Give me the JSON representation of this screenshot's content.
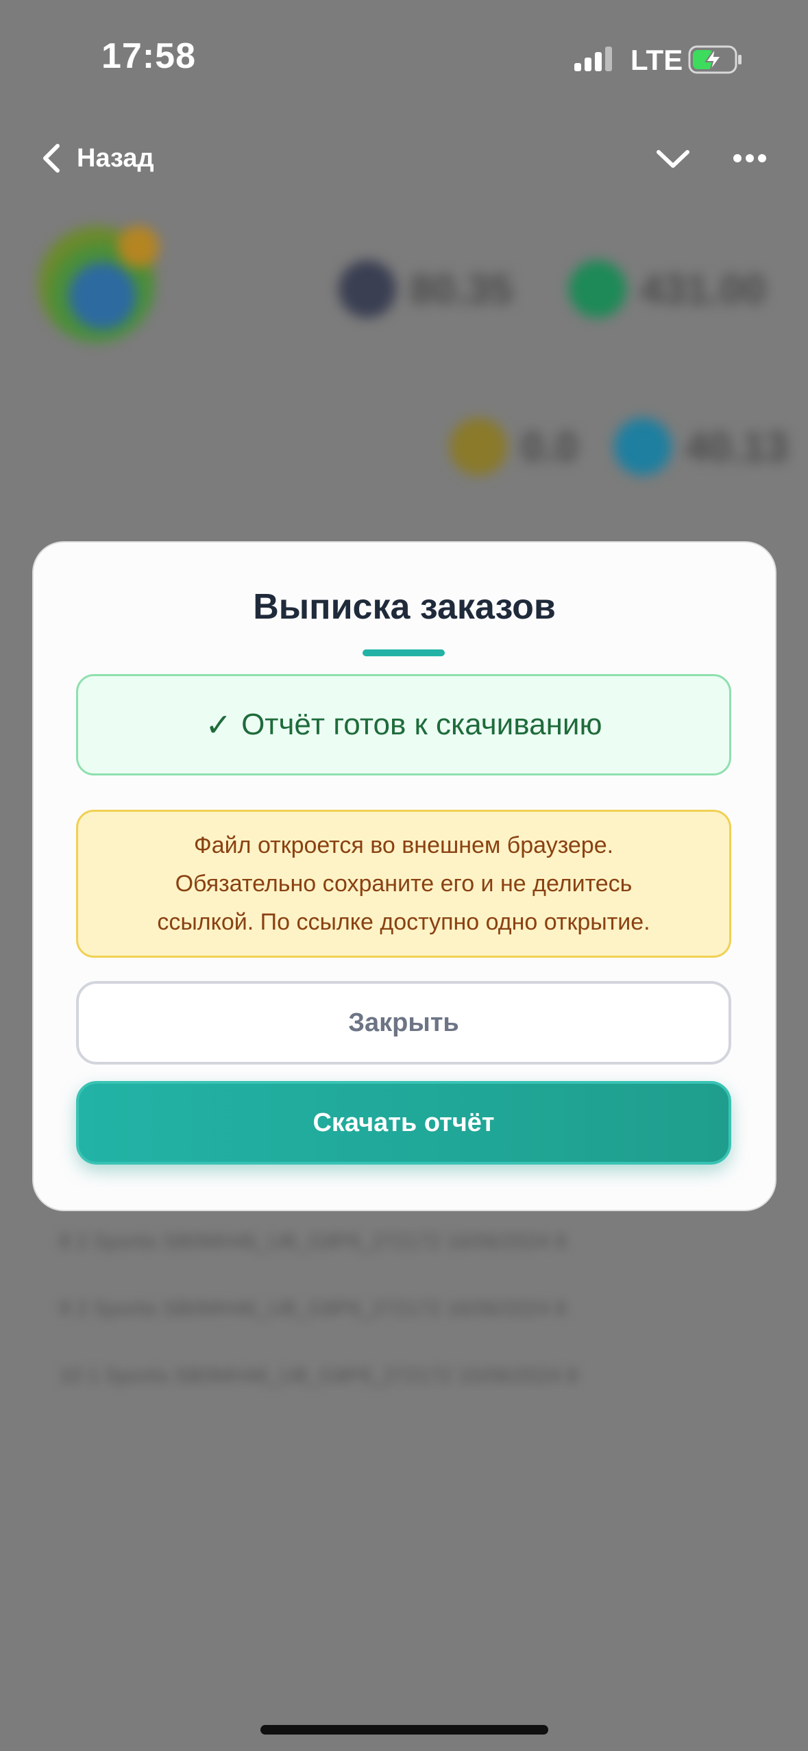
{
  "status_bar": {
    "time": "17:58",
    "network": "LTE",
    "signal_icon": "signal-bars-icon",
    "battery_icon": "battery-charging-icon"
  },
  "nav": {
    "back_label": "Назад",
    "back_icon": "chevron-left-icon",
    "collapse_icon": "chevron-down-icon",
    "more_icon": "more-horizontal-icon"
  },
  "background": {
    "chips_top": [
      {
        "value": "80.35",
        "color": "#3a3f52"
      },
      {
        "value": "431.00",
        "color": "#1d8a57"
      }
    ],
    "chips_bottom": [
      {
        "value": "0.0",
        "color": "#8a7a2a"
      },
      {
        "value": "40.13",
        "color": "#1e7fa0"
      }
    ],
    "rows": [
      "8   2   Sportis   SB0MH46_UB_G8P6_272172   16/06/2024   8",
      "9   2   Sportis   SB0MH46_UB_G8P6_272172   16/06/2024   8",
      "10  1   Sportis   SB0MH46_UB_G8P6_272172   15/06/2024   8"
    ]
  },
  "modal": {
    "title": "Выписка заказов",
    "success_text": "Отчёт готов к скачиванию",
    "success_icon": "check-icon",
    "warning_lines": [
      "Файл откроется во внешнем браузере.",
      "Обязательно сохраните его и не делитесь",
      "ссылкой. По ссылке доступно одно открытие."
    ],
    "close_label": "Закрыть",
    "download_label": "Скачать отчёт"
  },
  "colors": {
    "accent": "#22b3a6",
    "success_bg": "#ecfdf4",
    "success_text": "#1e6b3a",
    "warning_bg": "#fdf3c6",
    "warning_text": "#8a4112",
    "overlay": "#7c7c7c"
  }
}
